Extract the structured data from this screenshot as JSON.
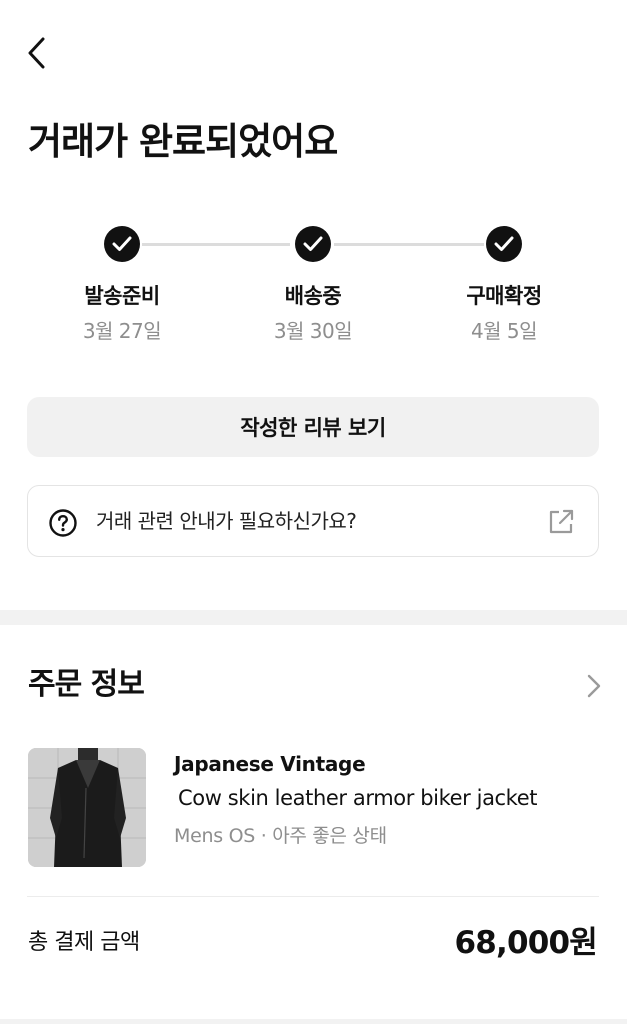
{
  "header": {
    "back_icon": "chevron-left-icon",
    "title": "거래가 완료되었어요"
  },
  "progress": {
    "steps": [
      {
        "label": "발송준비",
        "date": "3월 27일",
        "done": true
      },
      {
        "label": "배송중",
        "date": "3월 30일",
        "done": true
      },
      {
        "label": "구매확정",
        "date": "4월 5일",
        "done": true
      }
    ]
  },
  "actions": {
    "review_label": "작성한 리뷰 보기",
    "help_text": "거래 관련 안내가 필요하신가요?",
    "help_icon": "question-circle-icon",
    "external_icon": "external-link-icon"
  },
  "order": {
    "section_title": "주문 정보",
    "brand": "Japanese Vintage",
    "product_name": "Cow skin leather armor biker jacket",
    "meta": "Mens OS · 아주 좋은 상태",
    "total_label": "총 결제 금액",
    "total_value": "68,000원"
  },
  "colors": {
    "text": "#111111",
    "muted": "#8e8e8e",
    "button_bg": "#f1f1f1",
    "divider": "#f2f2f2",
    "step_done": "#111111"
  }
}
